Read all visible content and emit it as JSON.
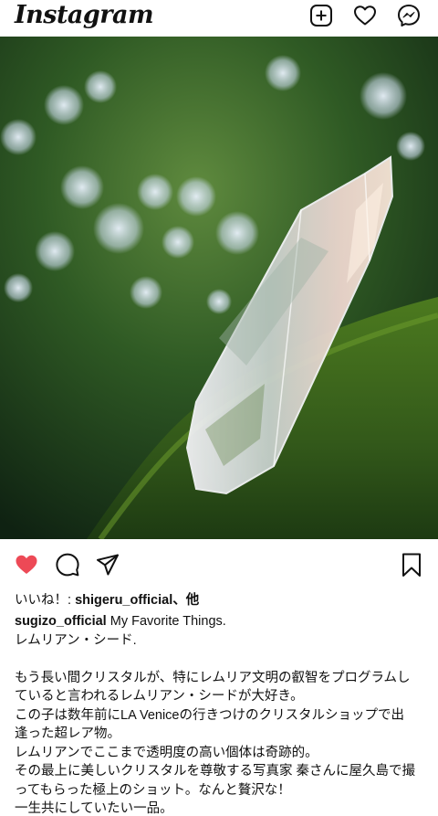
{
  "app": {
    "name": "Instagram"
  },
  "header": {
    "icons": [
      "add-post-icon",
      "activity-heart-icon",
      "messenger-icon"
    ]
  },
  "post": {
    "liked": true,
    "likes": {
      "prefix": "いいね！: ",
      "user": "shigeru_official",
      "suffix": "、他"
    },
    "caption": {
      "username": "sugizo_official",
      "first_line": " My Favorite Things.",
      "lines": [
        "レムリアン・シード.",
        "",
        "もう長い間クリスタルが、特にレムリア文明の叡智をプログラムし",
        "ていると言われるレムリアン・シードが大好き。",
        "この子は数年前にLA Veniceの行きつけのクリスタルショップで出",
        "逢った超レア物。",
        "レムリアンでここまで透明度の高い個体は奇跡的。",
        "その最上に美しいクリスタルを尊敬する写真家 秦さんに屋久島で撮",
        "ってもらった極上のショット。なんと贅沢な！",
        "一生共にしていたい一品。"
      ]
    },
    "image": {
      "subject": "clear quartz crystal on moss",
      "colors": {
        "moss": "#3f6a1c",
        "background": "#2c4a22",
        "crystal": "#e8e4ee"
      }
    }
  },
  "colors": {
    "like": "#ed4956",
    "text": "#111111"
  }
}
